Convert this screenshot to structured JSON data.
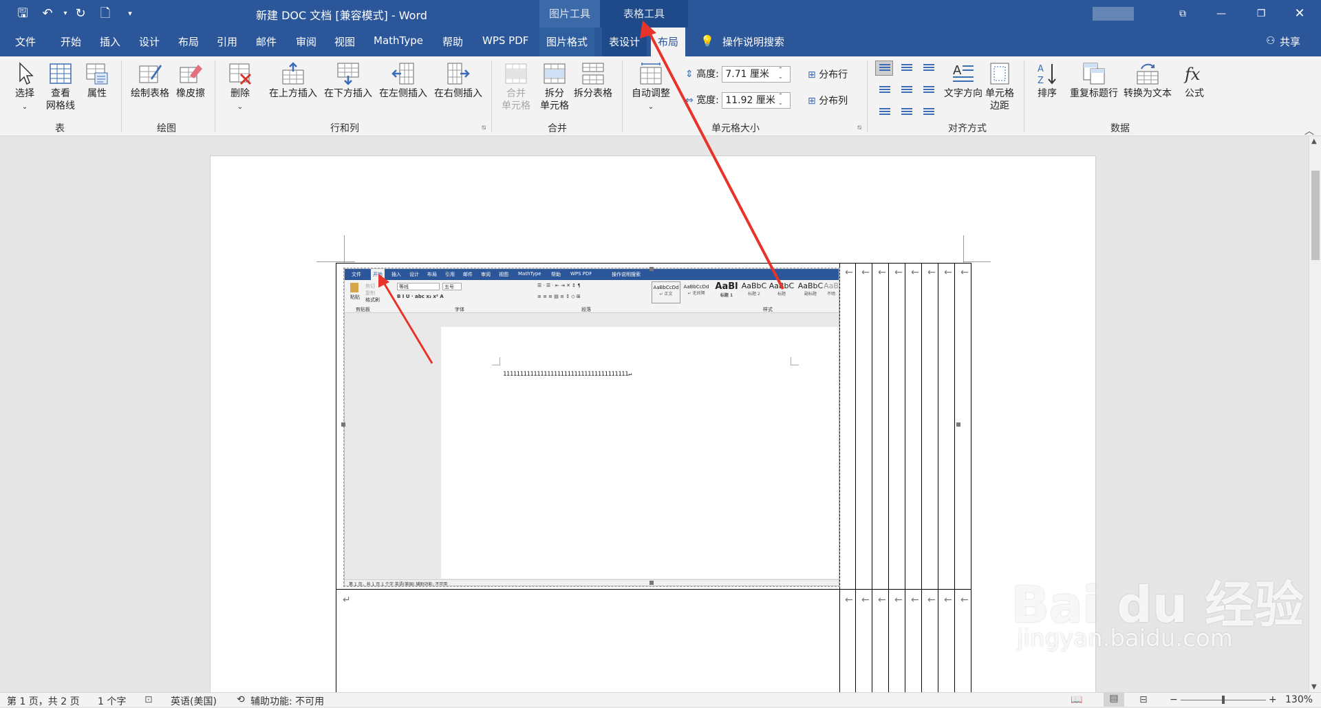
{
  "titlebar": {
    "doc_title": "新建 DOC 文档 [兼容模式]  -  Word",
    "context_pic_tools": "图片工具",
    "context_table_tools": "表格工具",
    "qa_save": "🖫",
    "qa_undo": "↶",
    "qa_redo": "↻",
    "qa_new": "🗋",
    "qa_more": "▾",
    "win_ribbon_opts": "⧉",
    "win_min": "—",
    "win_restore": "❐",
    "win_close": "✕"
  },
  "tabs": {
    "file": "文件",
    "home": "开始",
    "insert": "插入",
    "design": "设计",
    "layout": "布局",
    "references": "引用",
    "mailings": "邮件",
    "review": "审阅",
    "view": "视图",
    "mathtype": "MathType",
    "help": "帮助",
    "wpspdf": "WPS PDF",
    "picture_format": "图片格式",
    "table_design": "表设计",
    "table_layout": "布局",
    "tell_me": "操作说明搜索",
    "share": "共享"
  },
  "ribbon": {
    "table": {
      "select": "选择",
      "gridlines_1": "查看",
      "gridlines_2": "网格线",
      "properties": "属性",
      "label": "表"
    },
    "draw": {
      "draw_table": "绘制表格",
      "eraser": "橡皮擦",
      "label": "绘图"
    },
    "rows_cols": {
      "delete": "删除",
      "insert_above": "在上方插入",
      "insert_below": "在下方插入",
      "insert_left": "在左侧插入",
      "insert_right": "在右侧插入",
      "label": "行和列"
    },
    "merge": {
      "merge_cells_1": "合并",
      "merge_cells_2": "单元格",
      "split_cells_1": "拆分",
      "split_cells_2": "单元格",
      "split_table": "拆分表格",
      "label": "合并"
    },
    "cell_size": {
      "autofit": "自动调整",
      "height_label": "高度:",
      "height_value": "7.71 厘米",
      "width_label": "宽度:",
      "width_value": "11.92 厘米",
      "dist_rows": "分布行",
      "dist_cols": "分布列",
      "label": "单元格大小"
    },
    "alignment": {
      "text_direction": "文字方向",
      "cell_margins_1": "单元格",
      "cell_margins_2": "边距",
      "label": "对齐方式"
    },
    "data": {
      "sort": "排序",
      "repeat_header": "重复标题行",
      "convert_text": "转换为文本",
      "formula": "公式",
      "label": "数据"
    }
  },
  "embedded": {
    "tabs": [
      "文件",
      "开始",
      "插入",
      "设计",
      "布局",
      "引用",
      "邮件",
      "审阅",
      "视图",
      "MathType",
      "帮助",
      "WPS PDF",
      "操作说明搜索"
    ],
    "paste": "粘贴",
    "cut": "剪切",
    "copy": "复制",
    "format_painter": "格式刷",
    "clipboard": "剪贴板",
    "font_name": "等线",
    "font_size": "五号",
    "font": "字体",
    "paragraph": "段落",
    "styles": "样式",
    "style_items": [
      {
        "sample": "AaBbCcDd",
        "name": "↵ 正文"
      },
      {
        "sample": "AaBbCcDd",
        "name": "↵ 无间隔"
      },
      {
        "sample": "AaBl",
        "name": "标题 1"
      },
      {
        "sample": "AaBbC",
        "name": "标题 2"
      },
      {
        "sample": "AaBbC",
        "name": "标题"
      },
      {
        "sample": "AaBbC",
        "name": "副标题"
      },
      {
        "sample": "AaB",
        "name": "不明"
      }
    ],
    "doc_text": "1111111111111111111111111111111111111↵",
    "status": "第 1 页，共 1 页     1 个字     英语(美国)     辅助功能: 不可用"
  },
  "document": {
    "return_mark": "↵",
    "cell_mark": "←"
  },
  "watermark": {
    "logo": "Bai du 经验",
    "url": "jingyan.baidu.com"
  },
  "statusbar": {
    "page": "第 1 页，共 2 页",
    "words": "1 个字",
    "language": "英语(美国)",
    "accessibility": "辅助功能: 不可用",
    "zoom_minus": "−",
    "zoom_plus": "+",
    "zoom": "130%"
  }
}
